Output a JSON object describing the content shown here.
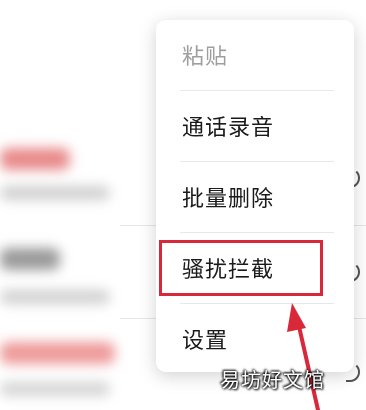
{
  "menu": {
    "items": [
      {
        "label": "粘贴",
        "state": "disabled"
      },
      {
        "label": "通话录音",
        "state": "enabled"
      },
      {
        "label": "批量删除",
        "state": "enabled"
      },
      {
        "label": "骚扰拦截",
        "state": "highlighted"
      },
      {
        "label": "设置",
        "state": "enabled"
      }
    ]
  },
  "annotation": {
    "highlight_color": "#d8283a",
    "arrow_color": "#d8283a"
  },
  "watermark": {
    "text": "易坊好文馆"
  },
  "icons": [
    "chevron-right-icon",
    "arrow-annotation-icon"
  ]
}
